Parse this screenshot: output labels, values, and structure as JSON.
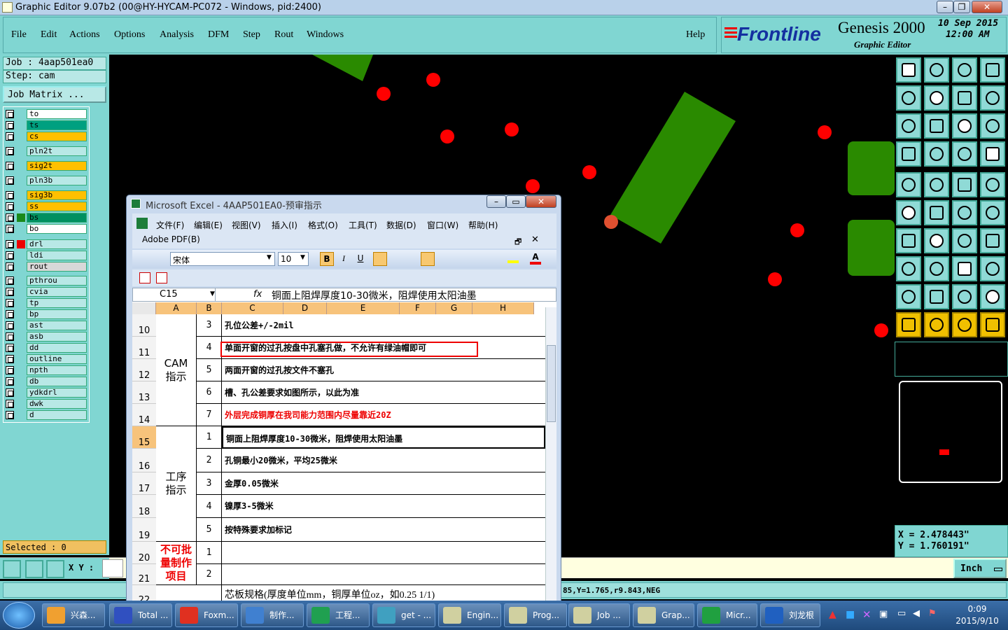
{
  "window": {
    "title": "Graphic Editor 9.07b2 (00@HY-HYCAM-PC072 - Windows, pid:2400)"
  },
  "menu": {
    "items": [
      "File",
      "Edit",
      "Actions",
      "Options",
      "Analysis",
      "DFM",
      "Step",
      "Rout",
      "Windows"
    ],
    "help": "Help"
  },
  "brand": {
    "logo": "Frontline",
    "product": "Genesis 2000",
    "subtitle": "Graphic Editor",
    "date": "10 Sep 2015",
    "time": "12:00 AM"
  },
  "job": {
    "job_label": "Job : 4aap501ea0",
    "step_label": "Step: cam",
    "matrix_button": "Job Matrix ..."
  },
  "layers": [
    {
      "name": "to",
      "color": "#ffffff"
    },
    {
      "name": "ts",
      "color": "#00a080"
    },
    {
      "name": "cs",
      "color": "#ffc000"
    },
    {
      "name": "pln2t",
      "color": "#b8e8e6"
    },
    {
      "name": "sig2t",
      "color": "#ffc000"
    },
    {
      "name": "pln3b",
      "color": "#b8e8e6"
    },
    {
      "name": "sig3b",
      "color": "#ffc000"
    },
    {
      "name": "ss",
      "color": "#ffc000"
    },
    {
      "name": "bs",
      "color": "#009060"
    },
    {
      "name": "bo",
      "color": "#ffffff"
    },
    {
      "name": "drl",
      "color": "#b8e8e6"
    },
    {
      "name": "ldi",
      "color": "#b8e8e6"
    },
    {
      "name": "rout",
      "color": "#d8d8d8"
    },
    {
      "name": "pthrou",
      "color": "#b8e8e6"
    },
    {
      "name": "cvia",
      "color": "#b8e8e6"
    },
    {
      "name": "tp",
      "color": "#b8e8e6"
    },
    {
      "name": "bp",
      "color": "#b8e8e6"
    },
    {
      "name": "ast",
      "color": "#b8e8e6"
    },
    {
      "name": "asb",
      "color": "#b8e8e6"
    },
    {
      "name": "dd",
      "color": "#b8e8e6"
    },
    {
      "name": "outline",
      "color": "#b8e8e6"
    },
    {
      "name": "npth",
      "color": "#b8e8e6"
    },
    {
      "name": "db",
      "color": "#b8e8e6"
    },
    {
      "name": "ydkdrl",
      "color": "#b8e8e6"
    },
    {
      "name": "dwk",
      "color": "#b8e8e6"
    },
    {
      "name": "d",
      "color": "#b8e8e6"
    }
  ],
  "selected": "Selected : 0",
  "coords": {
    "x": "X = 2.478443\"",
    "y": "Y = 1.760191\""
  },
  "cmd": {
    "xy_label": "X Y :",
    "units": "Inch"
  },
  "status": {
    "text": "85,Y=1.765,r9.843,NEG"
  },
  "excel": {
    "title": "Microsoft Excel - 4AAP501EA0-预审指示",
    "menus": [
      "文件(F)",
      "编辑(E)",
      "视图(V)",
      "插入(I)",
      "格式(O)",
      "工具(T)",
      "数据(D)",
      "窗口(W)",
      "帮助(H)"
    ],
    "adobe": "Adobe PDF(B)",
    "font": "宋体",
    "size": "10",
    "cellref": "C15",
    "formula": "铜面上阻焊厚度10-30微米，阻焊使用太阳油墨",
    "columns": [
      "A",
      "B",
      "C",
      "D",
      "E",
      "F",
      "G",
      "H"
    ],
    "groups": {
      "cam": "CAM\n指示",
      "process": "工序\n指示",
      "nobatch": "不可批\n量制作\n项目"
    },
    "rows": [
      {
        "num": "10",
        "idx": "3",
        "text": "孔位公差+/-2mil",
        "red": false
      },
      {
        "num": "11",
        "idx": "4",
        "text": "单面开窗的过孔按盘中孔塞孔做，不允许有绿油帽即可",
        "red": false
      },
      {
        "num": "12",
        "idx": "5",
        "text": "两面开窗的过孔按文件不塞孔",
        "red": false
      },
      {
        "num": "13",
        "idx": "6",
        "text": "槽、孔公差要求如图所示，以此为准",
        "red": false
      },
      {
        "num": "14",
        "idx": "7",
        "text": "外层完成铜厚在我司能力范围内尽量靠近20Z",
        "red": true
      },
      {
        "num": "15",
        "idx": "1",
        "text": "铜面上阻焊厚度10-30微米，阻焊使用太阳油墨",
        "red": false
      },
      {
        "num": "16",
        "idx": "2",
        "text": "孔铜最小20微米，平均25微米",
        "red": false
      },
      {
        "num": "17",
        "idx": "3",
        "text": "金厚0.05微米",
        "red": false
      },
      {
        "num": "18",
        "idx": "4",
        "text": "镍厚3-5微米",
        "red": false
      },
      {
        "num": "19",
        "idx": "5",
        "text": "按特殊要求加标记",
        "red": false
      },
      {
        "num": "20",
        "idx": "1",
        "text": "",
        "red": false
      },
      {
        "num": "21",
        "idx": "2",
        "text": "",
        "red": false
      },
      {
        "num": "22",
        "idx": "",
        "text": "芯板规格(厚度单位mm，铜厚单位oz，如0.25 1/1)",
        "red": false
      }
    ]
  },
  "taskbar": {
    "items": [
      "兴森...",
      "Total ...",
      "Foxm...",
      "制作...",
      "工程...",
      "get - ...",
      "Engin...",
      "Prog...",
      "Job ...",
      "Grap...",
      "Micr...",
      "刘龙根"
    ],
    "clock_time": "0:09",
    "clock_date": "2015/9/10"
  }
}
